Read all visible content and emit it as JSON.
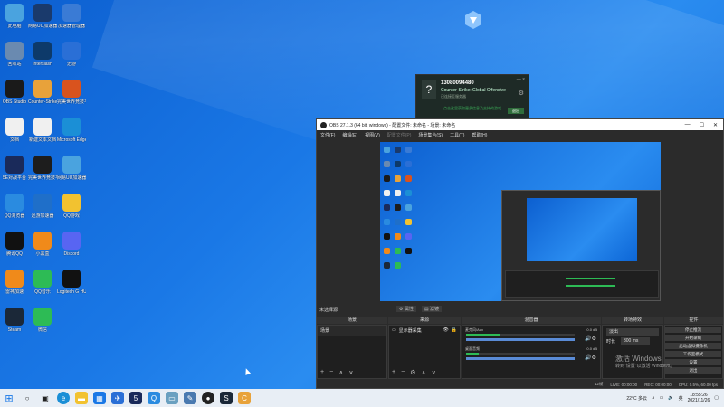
{
  "desktop": {
    "icons": [
      {
        "label": "此电脑",
        "icon": "computer-icon",
        "color": "#4aa3df"
      },
      {
        "label": "网易UU加速器",
        "icon": "uu-icon",
        "color": "#1a3a6c"
      },
      {
        "label": "加速器管理器",
        "icon": "manager-icon",
        "color": "#3a7bd5"
      },
      {
        "label": "回收站",
        "icon": "recycle-bin-icon",
        "color": "#6a8ab0"
      },
      {
        "label": "Interslash",
        "icon": "interslash-icon",
        "color": "#0d3a6a"
      },
      {
        "label": "迅游",
        "icon": "bird-icon",
        "color": "#2a6fd6"
      },
      {
        "label": "OBS Studio",
        "icon": "obs-icon",
        "color": "#1a1a1a"
      },
      {
        "label": "Counter-Strike: Global Offensive",
        "icon": "csgo-icon",
        "color": "#e8a23a"
      },
      {
        "label": "完美世界竞技平台",
        "icon": "perfect-world-icon",
        "color": "#d9531e"
      },
      {
        "label": "文档",
        "icon": "document-icon",
        "color": "#f0f0f0"
      },
      {
        "label": "新建文本文档",
        "icon": "text-file-icon",
        "color": "#f0f0f0"
      },
      {
        "label": "Microsoft Edge",
        "icon": "edge-icon",
        "color": "#1b8fd6"
      },
      {
        "label": "5E对战平台",
        "icon": "5e-icon",
        "color": "#1a2a5a"
      },
      {
        "label": "完美世界竞技平台",
        "icon": "pw-icon",
        "color": "#1d1d1d"
      },
      {
        "label": "网易UU加速器",
        "icon": "uu-booster-icon",
        "color": "#4aa3df"
      },
      {
        "label": "QQ浏览器",
        "icon": "qq-browser-icon",
        "color": "#2a8be0"
      },
      {
        "label": "迅游加速器",
        "icon": "xunyou-icon",
        "color": "#1f6fc9"
      },
      {
        "label": "QQ游戏",
        "icon": "qq-game-icon",
        "color": "#f2c230"
      },
      {
        "label": "腾讯QQ",
        "icon": "qq-icon",
        "color": "#111111"
      },
      {
        "label": "小黑盒",
        "icon": "box-icon",
        "color": "#f08a1a"
      },
      {
        "label": "Discord",
        "icon": "discord-icon",
        "color": "#5865f2"
      },
      {
        "label": "雷神加速",
        "icon": "thunder-icon",
        "color": "#f08a1a"
      },
      {
        "label": "QQ音乐",
        "icon": "qq-music-icon",
        "color": "#2dbb55"
      },
      {
        "label": "Logitech G HUB",
        "icon": "logitech-icon",
        "color": "#111111"
      },
      {
        "label": "Steam",
        "icon": "steam-icon",
        "color": "#1b2838"
      },
      {
        "label": "微信",
        "icon": "wechat-icon",
        "color": "#2dbb55"
      }
    ]
  },
  "popup": {
    "question": "?",
    "number": "13080094480",
    "game": "Counter-Strike: Global Offensive",
    "small": "已连接至服务器",
    "link": "点击这里获取更多信息及支持的游戏",
    "button": "退出"
  },
  "obs": {
    "title": "OBS 27.1.3 (64 bit, windows) - 配置文件: 未命名 - 场景: 未命名",
    "menu": [
      "文件(F)",
      "编辑(E)",
      "视图(V)",
      "配置文件(P)",
      "场景集合(S)",
      "工具(T)",
      "帮助(H)"
    ],
    "scene_status": "未选择源",
    "props_btn": "属性",
    "filter_btn": "滤镜",
    "docks": {
      "scenes": "场景",
      "sources": "来源",
      "mixer": "混音器",
      "transitions": "转场特效",
      "controls": "控件"
    },
    "scene_item": "场景",
    "source_item": "显示器采集",
    "mixer": [
      {
        "name": "麦克风/Aux",
        "db": "0.0 dB",
        "level": 0.32
      },
      {
        "name": "桌面音频",
        "db": "0.0 dB",
        "level": 0.12
      }
    ],
    "transition": {
      "type": "淡出",
      "duration_label": "时长",
      "duration": "300 ms"
    },
    "controls": [
      "停止推流",
      "开始录制",
      "启动虚拟摄像机",
      "工作室模式",
      "设置",
      "退出"
    ],
    "status": {
      "live": "LIVE: 00:00:00",
      "rec": "REC: 00:00:00",
      "cpu": "CPU: 0.5%, 60.00 fps",
      "dropped": "12帧"
    }
  },
  "watermark": {
    "line1": "激活 Windows",
    "line2": "转到\"设置\"以激活 Windows。"
  },
  "taskbar": {
    "weather": "22°C 多云",
    "lang": "英",
    "time": "18:55:26",
    "date": "2021/11/26"
  }
}
